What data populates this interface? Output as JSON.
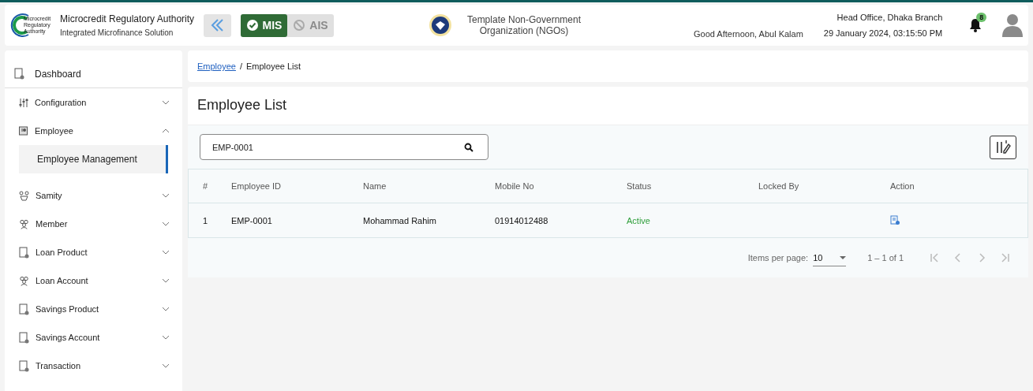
{
  "header": {
    "logo_lines": [
      "Microcredit",
      "Regulatory",
      "Authority"
    ],
    "org_name": "Microcredit Regulatory Authority",
    "org_subtitle": "Integrated Microfinance Solution",
    "modules": [
      {
        "label": "MIS",
        "selected": true
      },
      {
        "label": "AIS",
        "selected": false
      }
    ],
    "ngo_name": "Template Non-Government Organization (NGOs)",
    "greeting": "Good Afternoon, Abul Kalam",
    "branch": "Head Office, Dhaka Branch",
    "datetime": "29 January 2024, 03:15:50 PM",
    "notification_count": "8"
  },
  "sidebar": {
    "top": {
      "label": "Dashboard"
    },
    "items": [
      {
        "label": "Configuration",
        "kind": "sliders",
        "expanded": false
      },
      {
        "label": "Employee",
        "kind": "badge",
        "expanded": true,
        "children": [
          {
            "label": "Employee Management",
            "selected": true
          }
        ]
      },
      {
        "label": "Samity",
        "kind": "group",
        "expanded": false
      },
      {
        "label": "Member",
        "kind": "people",
        "expanded": false
      },
      {
        "label": "Loan Product",
        "kind": "document",
        "expanded": false
      },
      {
        "label": "Loan Account",
        "kind": "people",
        "expanded": false
      },
      {
        "label": "Savings Product",
        "kind": "document",
        "expanded": false
      },
      {
        "label": "Savings Account",
        "kind": "document",
        "expanded": false
      },
      {
        "label": "Transaction",
        "kind": "document",
        "expanded": false
      }
    ]
  },
  "breadcrumb": [
    {
      "label": "Employee",
      "kind": "link"
    },
    {
      "label": "/",
      "kind": "separator"
    },
    {
      "label": "Employee List",
      "kind": "current"
    }
  ],
  "page_title": "Employee List",
  "search": {
    "value": "EMP-0001"
  },
  "table": {
    "columns": [
      "#",
      "Employee ID",
      "Name",
      "Mobile No",
      "Status",
      "Locked By",
      "Action"
    ],
    "rows": [
      {
        "cells": [
          "1",
          "EMP-0001",
          "Mohammad Rahim",
          "01914012488",
          "Active",
          ""
        ]
      }
    ]
  },
  "pagination": {
    "label": "Items per page:",
    "page_size": "10",
    "range": "1 – 1 of 1",
    "buttons": [
      {
        "kind": "first",
        "disabled": true
      },
      {
        "kind": "prev",
        "disabled": true
      },
      {
        "kind": "next",
        "disabled": true
      },
      {
        "kind": "last",
        "disabled": true
      }
    ]
  }
}
